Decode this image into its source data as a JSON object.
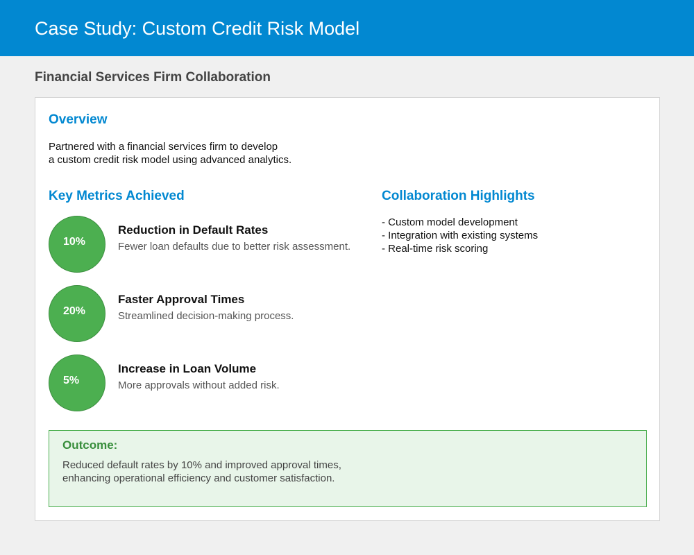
{
  "header": {
    "title": "Case Study: Custom Credit Risk Model",
    "background_color": "#0288d1"
  },
  "subtitle": "Financial Services Firm Collaboration",
  "overview": {
    "heading": "Overview",
    "text_lines": [
      "Partnered with a financial services firm to develop",
      "a custom credit risk model using advanced analytics."
    ]
  },
  "metrics": {
    "heading": "Key Metrics Achieved",
    "items": [
      {
        "value": "10%",
        "title": "Reduction in Default Rates",
        "description": "Fewer loan defaults due to better risk assessment."
      },
      {
        "value": "20%",
        "title": "Faster Approval Times",
        "description": "Streamlined decision-making process."
      },
      {
        "value": "5%",
        "title": "Increase in Loan Volume",
        "description": "More approvals without added risk."
      }
    ],
    "circle_color": "#4caf50"
  },
  "highlights": {
    "heading": "Collaboration Highlights",
    "items": [
      "- Custom model development",
      "- Integration with existing systems",
      "- Real-time risk scoring"
    ]
  },
  "outcome": {
    "heading": "Outcome:",
    "text_lines": [
      "Reduced default rates by 10% and improved approval times,",
      "enhancing operational efficiency and customer satisfaction."
    ],
    "background_color": "#e8f5e9",
    "accent_color": "#388e3c"
  }
}
